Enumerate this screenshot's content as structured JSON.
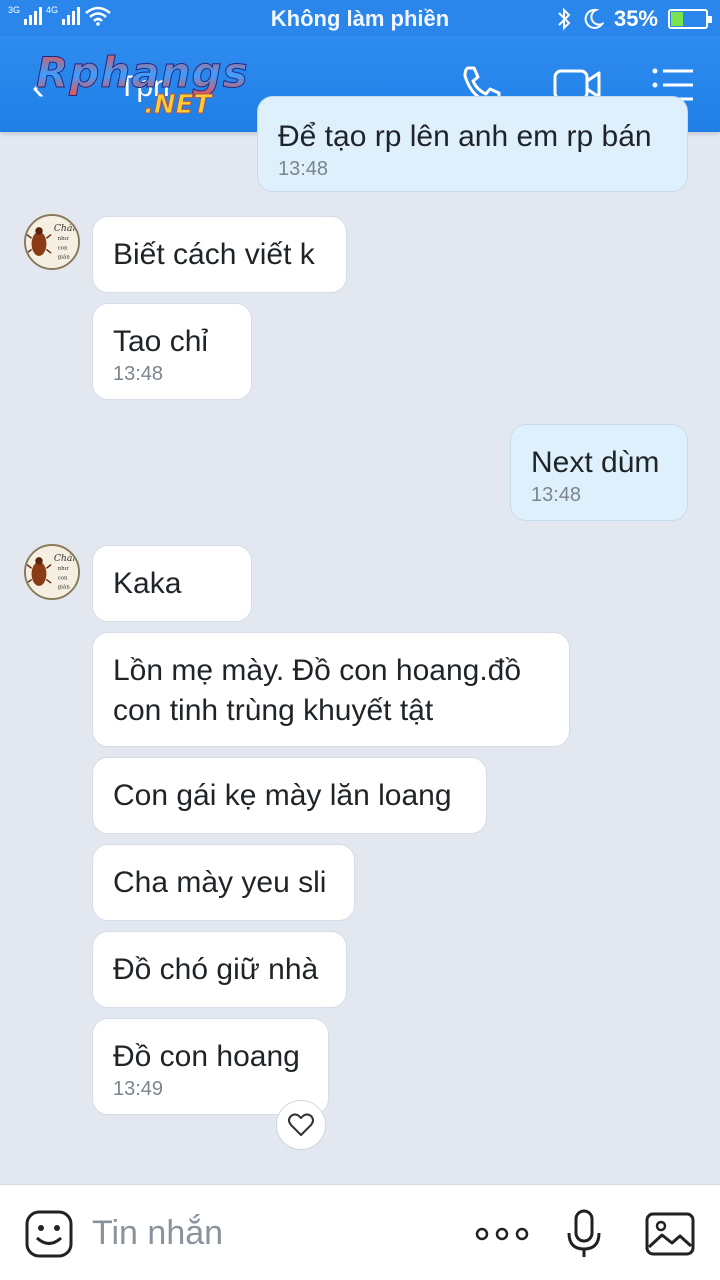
{
  "status_bar": {
    "network_1": "3G",
    "network_2": "4G",
    "title": "Không làm phiền",
    "battery_percent": "35%",
    "battery_level": 0.35
  },
  "header": {
    "back_icon": "back-arrow-icon",
    "contact_name": "Tpn",
    "watermark_main": "Rphangs",
    "watermark_sub": ".NET",
    "call_icon": "phone-icon",
    "video_icon": "video-camera-icon",
    "menu_icon": "menu-list-icon"
  },
  "messages": [
    {
      "id": "m0",
      "dir": "out",
      "text": "Để tạo rp lên anh em rp bán",
      "time": "13:48"
    },
    {
      "id": "m1",
      "dir": "in",
      "text": "Biết cách viết k",
      "time": ""
    },
    {
      "id": "m2",
      "dir": "in",
      "text": "Tao chỉ",
      "time": "13:48"
    },
    {
      "id": "m3",
      "dir": "out",
      "text": "Next dùm",
      "time": "13:48"
    },
    {
      "id": "m4",
      "dir": "in",
      "text": "Kaka",
      "time": ""
    },
    {
      "id": "m5",
      "dir": "in",
      "text": "Lồn mẹ mày. Đồ con hoang.đồ",
      "text2": "con tinh trùng khuyết tật",
      "time": ""
    },
    {
      "id": "m6",
      "dir": "in",
      "text": "Con gái kẹ mày lăn loang",
      "time": ""
    },
    {
      "id": "m7",
      "dir": "in",
      "text": "Cha mày yeu sli",
      "time": ""
    },
    {
      "id": "m8",
      "dir": "in",
      "text": "Đồ chó giữ nhà",
      "time": ""
    },
    {
      "id": "m9",
      "dir": "in",
      "text": "Đồ con hoang",
      "time": "13:49"
    }
  ],
  "avatar_text": [
    "Chán",
    "như",
    "con",
    "gián"
  ],
  "input": {
    "placeholder": "Tin nhắn",
    "emoji_icon": "emoji-icon",
    "more_icon": "more-dots-icon",
    "mic_icon": "microphone-icon",
    "image_icon": "image-icon"
  },
  "reaction_icon": "heart-icon"
}
